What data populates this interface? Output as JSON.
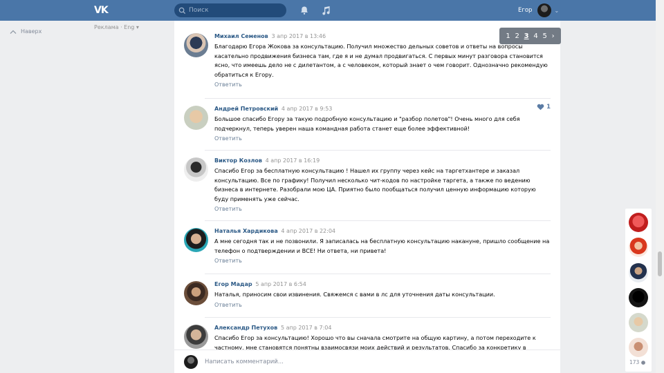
{
  "header": {
    "search_placeholder": "Поиск",
    "user_name": "Егор"
  },
  "left_nav": {
    "up_label": "Наверх",
    "ad_label": "Реклама · Eng ▾"
  },
  "pagination": {
    "pages": [
      "1",
      "2",
      "3",
      "4",
      "5"
    ],
    "current": "3",
    "next": "›"
  },
  "comments": [
    {
      "author": "Михаил Семенов",
      "date": "3 апр 2017 в 13:46",
      "text": "Благодарю Егора Жокова за консультацию. Получил множество дельных советов и ответы на вопросы касательно продвижения бизнеса там, где я и не думал продвигаться. С первых минут разговора становится ясно, что имеешь дело не с дилетантом, а с человеком, который знает о чем говорит. Однозначно рекомендую обратиться к Егору.",
      "reply": "Ответить",
      "likes": "1"
    },
    {
      "author": "Андрей Петровский",
      "date": "4 апр 2017 в 9:53",
      "text": "Большое спасибо Егору за такую подробную консультацию и \"разбор полетов\"! Очень много для себя подчеркнул, теперь уверен наша командная работа станет еще более эффективной!",
      "reply": "Ответить"
    },
    {
      "author": "Виктор Козлов",
      "date": "4 апр 2017 в 16:19",
      "text": "Спасибо Егор за бесплатную консультацию ! Нашел их группу через кейс на таргетхантере и заказал консультацию. Все по графику! Получил несколько чит-кодов по настройке таргета, а также по ведению бизнеса в интернете. Разобрали мою ЦА. Приятно было пообщаться получил ценную информацию которую буду применять уже сейчас.",
      "reply": "Ответить"
    },
    {
      "author": "Наталья Хардикова",
      "date": "4 апр 2017 в 22:04",
      "text": "А мне сегодня так и не позвонили. Я записалась на бесплатную консультацию накануне, пришло сообщение на телефон о подтверждении и ВСЕ! Ни ответа, ни привета!",
      "reply": "Ответить"
    },
    {
      "author": "Егор Мадар",
      "date": "5 апр 2017 в 6:54",
      "text": "Наталья, приносим свои извинения. Свяжемся с вами в лс для уточнения даты консультации.",
      "reply": "Ответить"
    },
    {
      "author": "Александр Петухов",
      "date": "5 апр 2017 в 7:04",
      "text": "Спасибо Егор за консультацию! Хорошо что вы сначала смотрите на общую картину, а потом переходите к частному, мне становятся понятны взаимосвязи моих действий и результатов. Спасибо за конкретику в",
      "reply": ""
    }
  ],
  "composer": {
    "placeholder": "Написать комментарий..."
  },
  "friends": {
    "online_count": "173"
  },
  "colors": {
    "brand": "#4a76a8",
    "link": "#2a5885",
    "background": "#edeef0"
  }
}
